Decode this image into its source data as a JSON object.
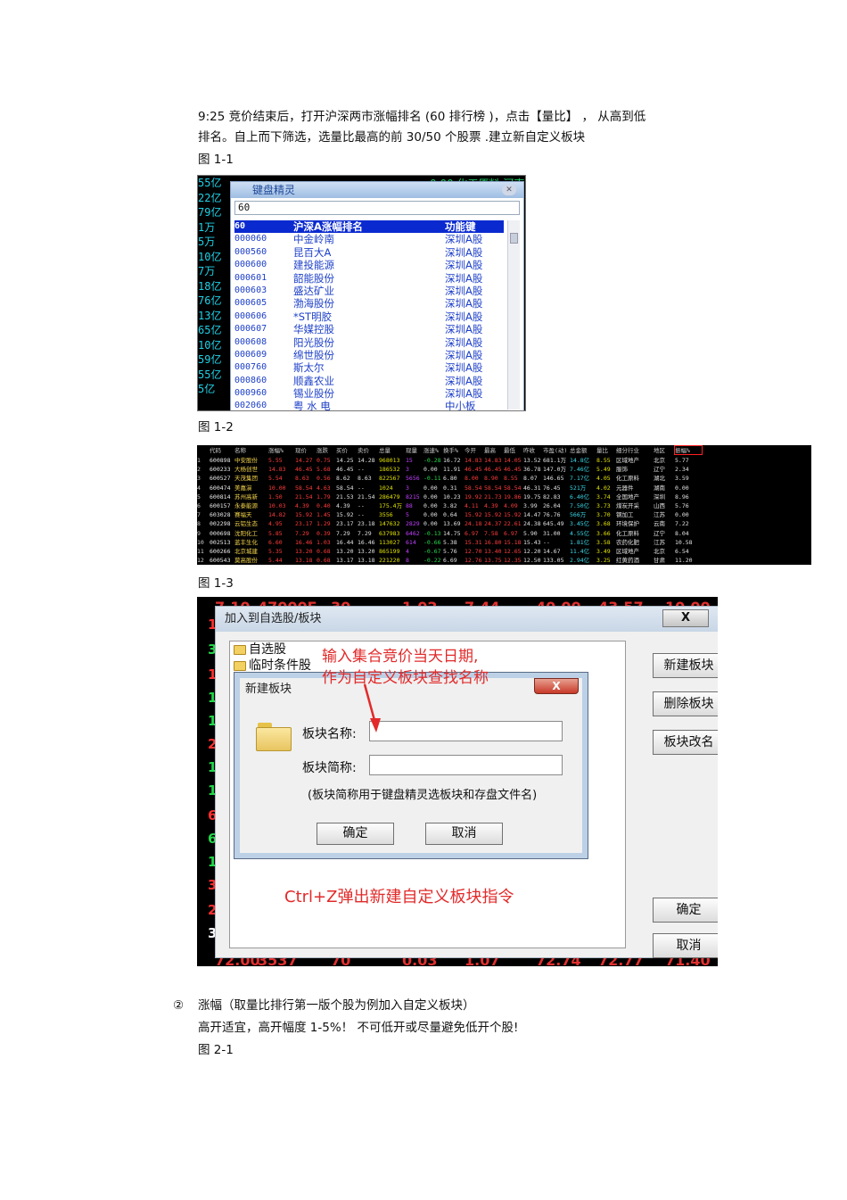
{
  "intro": {
    "line1": "9:25  竞价结束后，打开沪深两市涨幅排名         (60  排行榜 )，点击【量比】 ，  从高到低",
    "line2": "排名。自上而下筛选，选量比最高的前          30/50 个股票  .建立新自定义板块",
    "fig1_label": "图 1-1"
  },
  "fig1_1": {
    "left_values": [
      "55亿",
      "22亿",
      "79亿",
      "1万",
      "5万",
      "10亿",
      "7万",
      "18亿",
      "76亿",
      "13亿",
      "65亿",
      "10亿",
      "59亿",
      "55亿",
      "5亿"
    ],
    "top_strip": "0.00   化工原料   河南",
    "window_title": "键盘精灵",
    "close_symbol": "✕",
    "input_value": "60",
    "header": {
      "code": "60",
      "name": "沪深A涨幅排名",
      "type": "功能键"
    },
    "rows": [
      {
        "code": "000060",
        "name": "中金岭南",
        "type": "深圳A股"
      },
      {
        "code": "000560",
        "name": "昆百大A",
        "type": "深圳A股"
      },
      {
        "code": "000600",
        "name": "建投能源",
        "type": "深圳A股"
      },
      {
        "code": "000601",
        "name": "韶能股份",
        "type": "深圳A股"
      },
      {
        "code": "000603",
        "name": "盛达矿业",
        "type": "深圳A股"
      },
      {
        "code": "000605",
        "name": "渤海股份",
        "type": "深圳A股"
      },
      {
        "code": "000606",
        "name": "*ST明胶",
        "type": "深圳A股"
      },
      {
        "code": "000607",
        "name": "华媒控股",
        "type": "深圳A股"
      },
      {
        "code": "000608",
        "name": "阳光股份",
        "type": "深圳A股"
      },
      {
        "code": "000609",
        "name": "绵世股份",
        "type": "深圳A股"
      },
      {
        "code": "000760",
        "name": "斯太尔",
        "type": "深圳A股"
      },
      {
        "code": "000860",
        "name": "顺鑫农业",
        "type": "深圳A股"
      },
      {
        "code": "000960",
        "name": "锡业股份",
        "type": "深圳A股"
      },
      {
        "code": "002060",
        "name": "粤 水 电",
        "type": "中小板"
      }
    ]
  },
  "fig1_2": {
    "label": "图 1-2",
    "headers": [
      "代码",
      "名称",
      "涨幅%",
      "现价",
      "涨跌",
      "买价",
      "卖价",
      "总量",
      "现量",
      "涨速%",
      "换手%",
      "今开",
      "最高",
      "最低",
      "昨收",
      "市盈(动)",
      "总金额",
      "量比",
      "细分行业",
      "地区",
      "振幅%"
    ],
    "rows": [
      [
        "1",
        "600898",
        "中安股份",
        "5.55",
        "14.27",
        "0.75",
        "14.25",
        "14.28",
        "968013",
        "15",
        "-0.28",
        "16.72",
        "14.83",
        "14.83",
        "14.05",
        "13.52",
        "681.1万",
        "14.8亿",
        "8.55",
        "区域地产",
        "北京",
        "5.77"
      ],
      [
        "2",
        "600233",
        "大杨创世",
        "14.83",
        "46.45",
        "5.68",
        "46.45",
        "--",
        "186532",
        "3",
        "0.00",
        "11.91",
        "46.45",
        "46.45",
        "46.45",
        "36.78",
        "147.0万",
        "7.46亿",
        "5.49",
        "服饰",
        "辽宁",
        "2.34"
      ],
      [
        "3",
        "600527",
        "天茂集团",
        "5.54",
        "8.63",
        "0.56",
        "8.62",
        "8.63",
        "822567",
        "5656",
        "-0.11",
        "6.80",
        "8.00",
        "8.90",
        "8.55",
        "8.07",
        "146.65",
        "7.17亿",
        "4.05",
        "化工原料",
        "湖北",
        "3.59"
      ],
      [
        "4",
        "600474",
        "美嘉演",
        "10.00",
        "58.54",
        "4.63",
        "58.54",
        "--",
        "1024",
        "3",
        "0.00",
        "0.31",
        "58.54",
        "58.54",
        "58.54",
        "46.31",
        "76.45",
        "521万",
        "4.02",
        "元器件",
        "湖南",
        "0.00"
      ],
      [
        "5",
        "600814",
        "苏州高新",
        "1.50",
        "21.54",
        "1.79",
        "21.53",
        "21.54",
        "286479",
        "8215",
        "0.00",
        "10.23",
        "19.92",
        "21.73",
        "19.86",
        "19.75",
        "82.83",
        "6.40亿",
        "3.74",
        "全国地产",
        "深圳",
        "8.96"
      ],
      [
        "6",
        "600157",
        "永泰能源",
        "10.03",
        "4.39",
        "0.40",
        "4.39",
        "--",
        "175.4万",
        "88",
        "0.00",
        "3.82",
        "4.11",
        "4.39",
        "4.09",
        "3.99",
        "26.04",
        "7.50亿",
        "3.73",
        "煤炭开采",
        "山西",
        "5.76"
      ],
      [
        "7",
        "603028",
        "赛福天",
        "14.82",
        "15.92",
        "1.45",
        "15.92",
        "--",
        "3556",
        "5",
        "0.00",
        "0.64",
        "15.92",
        "15.92",
        "15.92",
        "14.47",
        "76.76",
        "566万",
        "3.70",
        "钢加工",
        "江苏",
        "0.00"
      ],
      [
        "8",
        "002298",
        "云铝生态",
        "4.95",
        "23.17",
        "1.29",
        "23.17",
        "23.18",
        "147632",
        "2829",
        "0.00",
        "13.69",
        "24.18",
        "24.37",
        "22.61",
        "24.38",
        "645.49",
        "3.45亿",
        "3.68",
        "环境保护",
        "云南",
        "7.22"
      ],
      [
        "9",
        "000698",
        "沈阳化工",
        "5.85",
        "7.29",
        "0.39",
        "7.29",
        "7.29",
        "637983",
        "6462",
        "-0.13",
        "14.75",
        "6.97",
        "7.58",
        "6.97",
        "5.90",
        "31.00",
        "4.55亿",
        "3.66",
        "化工原料",
        "辽宁",
        "8.04"
      ],
      [
        "10",
        "002513",
        "蓝丰生化",
        "6.60",
        "16.46",
        "1.03",
        "16.44",
        "16.46",
        "113027",
        "614",
        "-0.66",
        "5.38",
        "15.31",
        "16.80",
        "15.18",
        "15.43",
        "--",
        "1.81亿",
        "3.58",
        "农药化肥",
        "江苏",
        "10.58"
      ],
      [
        "11",
        "600266",
        "北京城建",
        "5.35",
        "13.20",
        "0.68",
        "13.20",
        "13.20",
        "865199",
        "4",
        "-0.67",
        "5.76",
        "12.70",
        "13.40",
        "12.65",
        "12.20",
        "14.67",
        "11.4亿",
        "3.49",
        "区域地产",
        "北京",
        "6.54"
      ],
      [
        "12",
        "600543",
        "莫高股份",
        "5.44",
        "13.18",
        "0.68",
        "13.17",
        "13.18",
        "221220",
        "8",
        "-0.22",
        "6.69",
        "12.76",
        "13.75",
        "12.35",
        "12.50",
        "133.05",
        "2.94亿",
        "3.25",
        "红黄药酒",
        "甘肃",
        "11.20"
      ]
    ],
    "colors": {
      "header": "#c8c8c8",
      "index": "#d0d0d0",
      "code": "#e8e8e8",
      "name": "#f2d24a",
      "up": "#ff3b3b",
      "down": "#22d84a",
      "neutral": "#e0e0e0",
      "cyan": "#38d8e8",
      "purple": "#c040ff",
      "volume": "#e0e000"
    }
  },
  "fig1_3": {
    "label": "图 1-3",
    "bg_top": [
      "7.10",
      "47000E",
      "30",
      "1.02",
      "7.44",
      "40.00",
      "43.57",
      "10.00"
    ],
    "bg_bottom": [
      "72.00",
      "3537",
      "70",
      "0.03",
      "1.07",
      "72.74",
      "72.77",
      "71.40"
    ],
    "left_digits": [
      "1",
      "3",
      "1",
      "1",
      "1",
      "2",
      "1",
      "1",
      "6",
      "6",
      "1",
      "3",
      "2",
      "3",
      "2"
    ],
    "outer_dialog": {
      "title": "加入到自选股/板块",
      "close": "X",
      "tree": [
        "自选股",
        "临时条件股"
      ],
      "buttons": [
        "新建板块",
        "删除板块",
        "板块改名"
      ],
      "ok": "确定",
      "cancel": "取消"
    },
    "inner_dialog": {
      "title": "新建板块",
      "close": "X",
      "name_label": "板块名称:",
      "short_label": "板块简称:",
      "note": "(板块简称用于键盘精灵选板块和存盘文件名)",
      "ok": "确定",
      "cancel": "取消"
    },
    "annotation1_line1": "输入集合竞价当天日期,",
    "annotation1_line2": "作为自定义板块查找名称",
    "annotation2": "Ctrl+Z弹出新建自定义板块指令"
  },
  "section2": {
    "marker": "②",
    "heading": "涨幅（取量比排行第一版个股为例加入自定义板块）",
    "line": "高开适宜，高开幅度      1-5%！ 不可低开或尽量避免低开个股!",
    "fig_label": "图 2-1"
  }
}
